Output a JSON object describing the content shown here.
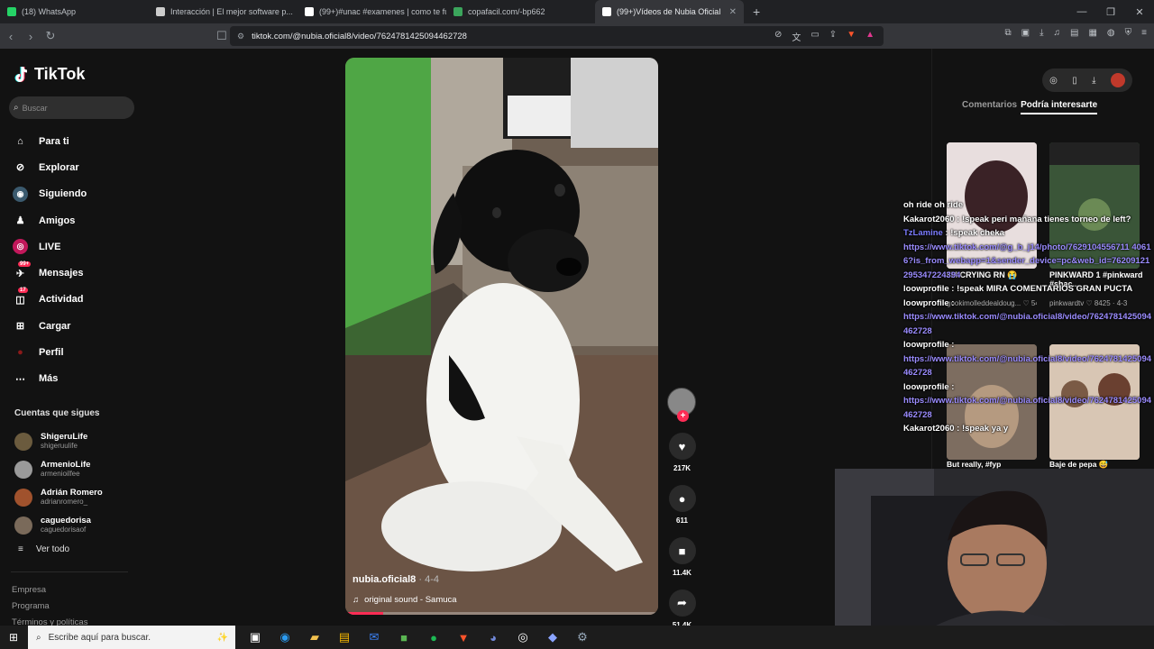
{
  "browser": {
    "tabs": [
      {
        "label": "(18) WhatsApp",
        "color": "#25d366"
      },
      {
        "label": "Interacción | El mejor software p...",
        "color": "#cccccc"
      },
      {
        "label": "(99+)#unac #examenes | como te fu...",
        "color": "#ffffff"
      },
      {
        "label": "copafacil.com/-bp662",
        "color": "#3ba55c"
      },
      {
        "label": "(99+)Vídeos de Nubia Oficial",
        "color": "#ffffff"
      }
    ],
    "url": "tiktok.com/@nubia.oficial8/video/7624781425094462728"
  },
  "sidebar": {
    "logo": "TikTok",
    "search_placeholder": "Buscar",
    "nav": [
      {
        "label": "Para ti",
        "icon": "home-icon"
      },
      {
        "label": "Explorar",
        "icon": "compass-icon"
      },
      {
        "label": "Siguiendo",
        "icon": "following-icon"
      },
      {
        "label": "Amigos",
        "icon": "friends-icon"
      },
      {
        "label": "LIVE",
        "icon": "live-icon"
      },
      {
        "label": "Mensajes",
        "icon": "messages-icon",
        "badge": "99+"
      },
      {
        "label": "Actividad",
        "icon": "activity-icon",
        "badge": "17"
      },
      {
        "label": "Cargar",
        "icon": "upload-icon"
      },
      {
        "label": "Perfil",
        "icon": "profile-icon"
      },
      {
        "label": "Más",
        "icon": "more-icon"
      }
    ],
    "following_title": "Cuentas que sigues",
    "following": [
      {
        "name": "ShigeruLife",
        "user": "shigeruulife",
        "color": "#6b5b3e"
      },
      {
        "name": "ArmenioLife",
        "user": "armenioilfee",
        "color": "#9a9a9a"
      },
      {
        "name": "Adrián Romero",
        "user": "adrianromero_",
        "color": "#a0522d"
      },
      {
        "name": "caguedorisa",
        "user": "caguedorisaof",
        "color": "#7a6a5a"
      }
    ],
    "see_all": "Ver todo",
    "footer": [
      "Empresa",
      "Programa",
      "Términos y políticas"
    ]
  },
  "video": {
    "author": "nubia.oficial8",
    "date": " · 4-4",
    "sound": "original sound - Samuca",
    "progress": 0.12
  },
  "actions": {
    "likes": "217K",
    "comments": "611",
    "saves": "11.4K",
    "shares": "51.4K"
  },
  "right_panel": {
    "tab_comments": "Comentarios",
    "tab_suggested": "Podría interesarte",
    "thumbs": [
      {
        "title": "I'M CRYING RN 😭",
        "meta": "gookimolleddealdoug...  ♡ 5488 · Hace..."
      },
      {
        "title": "PINKWARD 1 #pinkward #shac...",
        "meta": "pinkwardtv  ♡ 8425 · 4-3"
      },
      {
        "title": "But really, #fyp",
        "meta": ""
      },
      {
        "title": "Baje de pepa 😅",
        "meta": ""
      }
    ]
  },
  "chat": [
    {
      "user": "",
      "text": "oh ride oh ride"
    },
    {
      "user": "Kakarot2060",
      "text": " : !speak peri mañana tienes torneo de left?"
    },
    {
      "user": "TzLamine",
      "text": " : !speak cheka",
      "tz": true
    },
    {
      "link": "https://www.tiktok.com/@g_b_j14/photo/7629104556711 40616?is_from_webapp=1&sender_device=pc&web_id=76209121295347224394"
    },
    {
      "user": "loowprofile",
      "text": " : !speak MIRA COMENTARIOS GRAN PUCTA"
    },
    {
      "user": "loowprofile",
      "text": " :"
    },
    {
      "link": "https://www.tiktok.com/@nubia.oficial8/video/7624781425094462728"
    },
    {
      "user": "loowprofile",
      "text": " :"
    },
    {
      "link": "https://www.tiktok.com/@nubia.oficial8/video/7624781425094462728"
    },
    {
      "user": "loowprofile",
      "text": " :"
    },
    {
      "link": "https://www.tiktok.com/@nubia.oficial8/video/7624781425094462728"
    },
    {
      "user": "Kakarot2060",
      "text": " : !speak ya y"
    }
  ],
  "taskbar": {
    "search_placeholder": "Escribe aquí para buscar."
  }
}
